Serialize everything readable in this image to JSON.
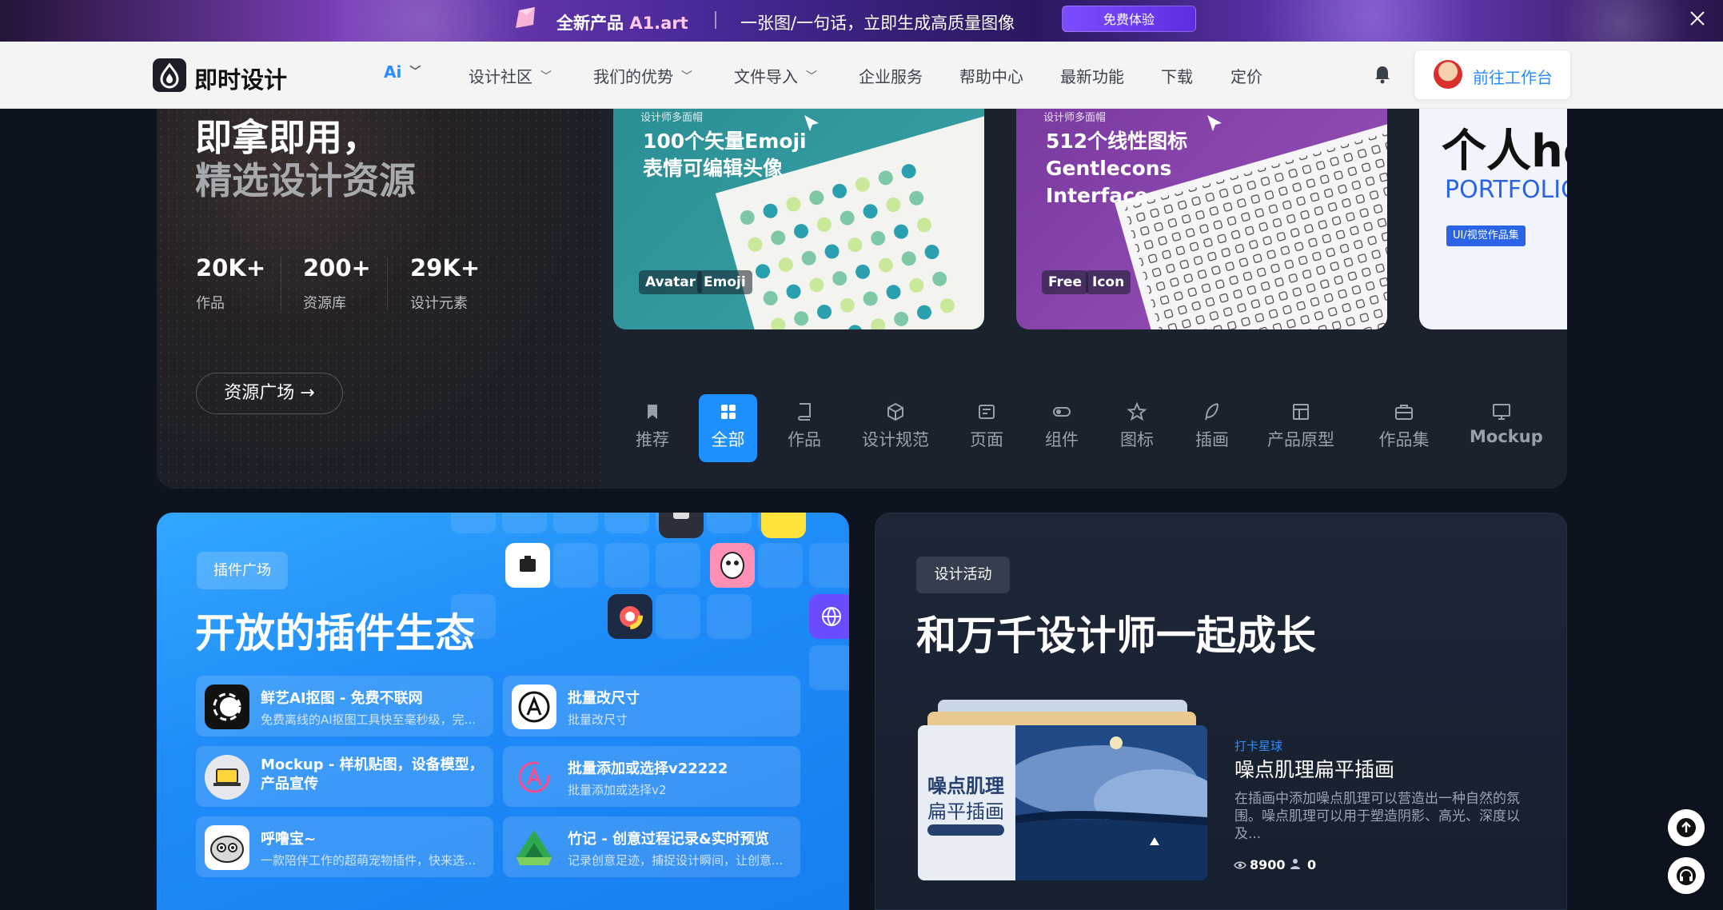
{
  "promo": {
    "new_label": "全新产品",
    "brand": "A1.art",
    "text": "一张图/一句话，立即生成高质量图像",
    "button": "免费体验"
  },
  "nav": {
    "logo_text": "即时设计",
    "ai_label": "Ai",
    "items": [
      "设计社区",
      "我们的优势",
      "文件导入",
      "企业服务",
      "帮助中心",
      "最新功能",
      "下载",
      "定价"
    ],
    "workspace_button": "前往工作台"
  },
  "hero": {
    "title_line1": "即拿即用，",
    "title_line2": "精选设计资源",
    "stats": [
      {
        "value": "20K+",
        "label": "作品"
      },
      {
        "value": "200+",
        "label": "资源库"
      },
      {
        "value": "29K+",
        "label": "设计元素"
      }
    ],
    "cta": "资源广场 →",
    "cards": [
      {
        "subtitle": "设计师多面帽",
        "title_lines": [
          "100个矢量Emoji",
          "表情可编辑头像"
        ],
        "tags": [
          "Avatar",
          "Emoji"
        ]
      },
      {
        "subtitle": "设计师多面帽",
        "title_lines": [
          "512个线性图标",
          "Gentlecons",
          "Interface"
        ],
        "tags": [
          "Free",
          "Icon"
        ]
      },
      {
        "title": "个人hos",
        "subtitle": "PORTFOLIO",
        "badge": "UI/视觉作品集"
      }
    ],
    "categories": [
      "推荐",
      "全部",
      "作品",
      "设计规范",
      "页面",
      "组件",
      "图标",
      "插画",
      "产品原型",
      "作品集",
      "Mockup"
    ],
    "active_category": "全部"
  },
  "plugins": {
    "chip": "插件广场",
    "title": "开放的插件生态",
    "items": [
      {
        "title": "鲜艺AI抠图 - 免费不联网",
        "desc": "免费离线的AI抠图工具快至毫秒级，完..."
      },
      {
        "title": "批量改尺寸",
        "desc": "批量改尺寸"
      },
      {
        "title": "Mockup - 样机贴图，设备模型，",
        "title2": "产品宣传",
        "desc": ""
      },
      {
        "title": "批量添加或选择v22222",
        "desc": "批量添加或选择v2"
      },
      {
        "title": "呼噜宝~",
        "desc": "一款陪伴工作的超萌宠物插件，快来选..."
      },
      {
        "title": "竹记 - 创意过程记录&实时预览",
        "desc": "记录创意足迹，捕捉设计瞬间，让创意..."
      }
    ]
  },
  "activity": {
    "chip": "设计活动",
    "title": "和万千设计师一起成长",
    "thumb_title1": "噪点肌理",
    "thumb_title2": "扁平插画",
    "meta": "打卡星球",
    "name": "噪点肌理扁平插画",
    "desc": "在插画中添加噪点肌理可以营造出一种自然的氛围。噪点肌理可以用于塑造阴影、高光、深度以及...",
    "views": "8900",
    "users": "0"
  },
  "colors": {
    "accent": "#1e90ff",
    "link": "#2a8cff",
    "promo_button": "#6a3cf0"
  }
}
